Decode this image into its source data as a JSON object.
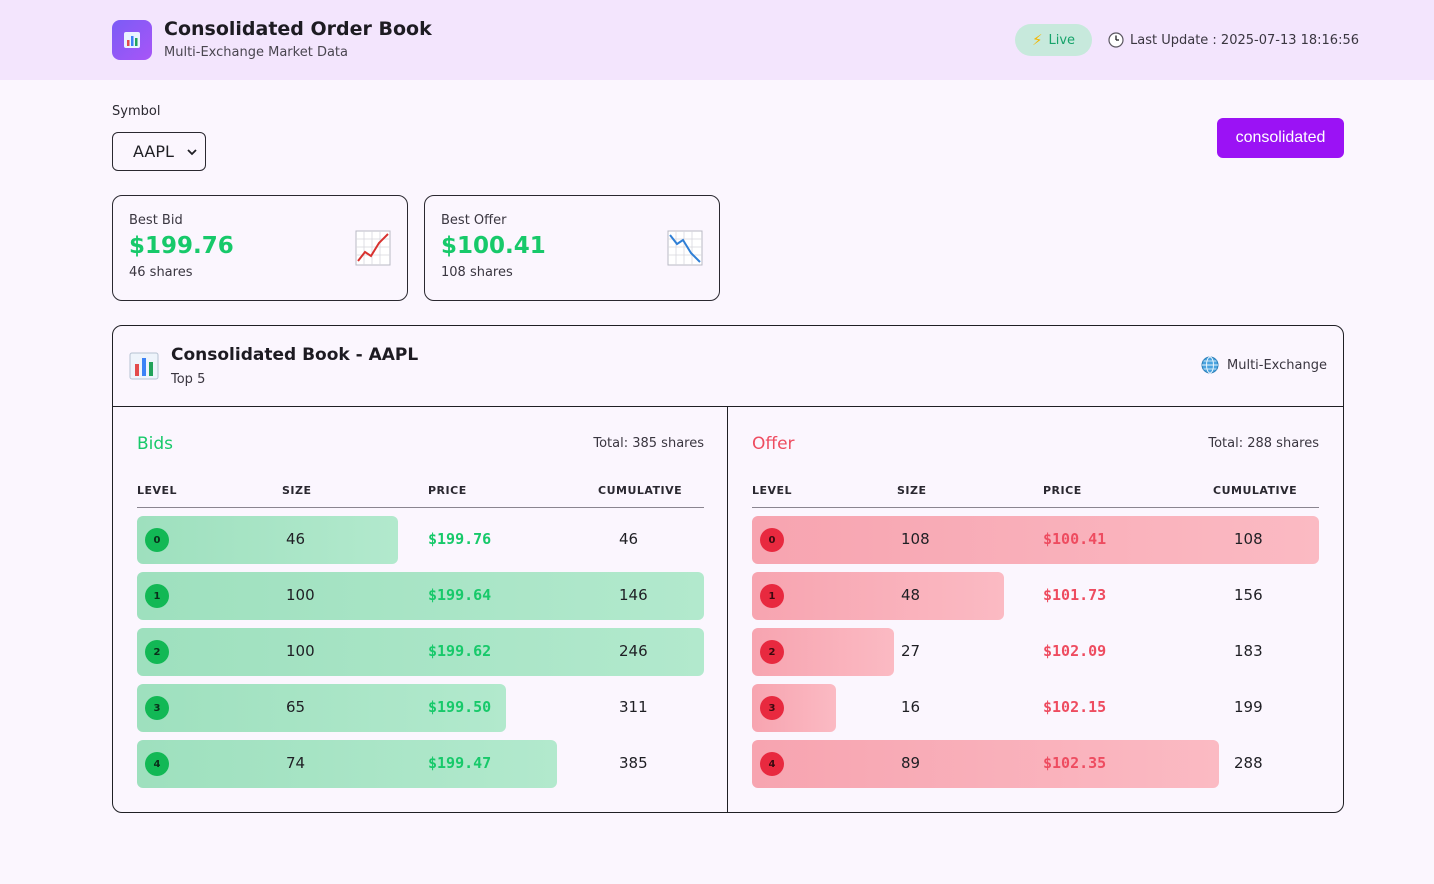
{
  "header": {
    "title": "Consolidated Order Book",
    "subtitle": "Multi-Exchange Market Data",
    "status": "Live",
    "last_update": "Last Update : 2025-07-13 18:16:56"
  },
  "controls": {
    "symbol_label": "Symbol",
    "symbol_value": "AAPL",
    "mode_button": "consolidated"
  },
  "best_bid": {
    "label": "Best Bid",
    "price": "$199.76",
    "shares": "46 shares"
  },
  "best_offer": {
    "label": "Best Offer",
    "price": "$100.41",
    "shares": "108 shares"
  },
  "book": {
    "title": "Consolidated Book - AAPL",
    "subtitle": "Top 5",
    "source": "Multi-Exchange",
    "columns": [
      "LEVEL",
      "SIZE",
      "PRICE",
      "CUMULATIVE"
    ],
    "bids": {
      "title": "Bids",
      "total": "Total: 385 shares",
      "rows": [
        {
          "level": "0",
          "size": "46",
          "price": "$199.76",
          "cumulative": "46",
          "fill": 0.46
        },
        {
          "level": "1",
          "size": "100",
          "price": "$199.64",
          "cumulative": "146",
          "fill": 1.0
        },
        {
          "level": "2",
          "size": "100",
          "price": "$199.62",
          "cumulative": "246",
          "fill": 1.0
        },
        {
          "level": "3",
          "size": "65",
          "price": "$199.50",
          "cumulative": "311",
          "fill": 0.65
        },
        {
          "level": "4",
          "size": "74",
          "price": "$199.47",
          "cumulative": "385",
          "fill": 0.74
        }
      ]
    },
    "offers": {
      "title": "Offer",
      "total": "Total: 288 shares",
      "rows": [
        {
          "level": "0",
          "size": "108",
          "price": "$100.41",
          "cumulative": "108",
          "fill": 1.0
        },
        {
          "level": "1",
          "size": "48",
          "price": "$101.73",
          "cumulative": "156",
          "fill": 0.444
        },
        {
          "level": "2",
          "size": "27",
          "price": "$102.09",
          "cumulative": "183",
          "fill": 0.25
        },
        {
          "level": "3",
          "size": "16",
          "price": "$102.15",
          "cumulative": "199",
          "fill": 0.148
        },
        {
          "level": "4",
          "size": "89",
          "price": "$102.35",
          "cumulative": "288",
          "fill": 0.824
        }
      ]
    }
  },
  "colors": {
    "accent": "#9b12f5",
    "bid": "#17c96a",
    "offer": "#ee4c60"
  }
}
